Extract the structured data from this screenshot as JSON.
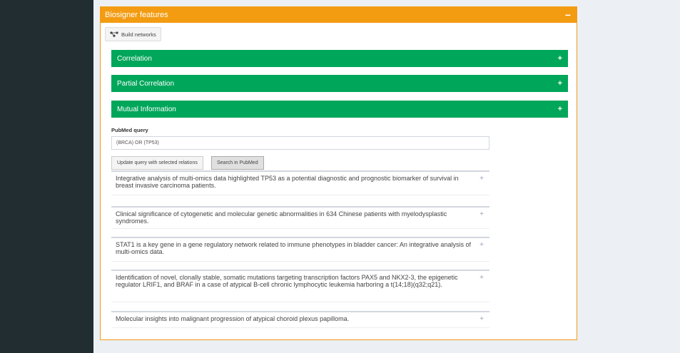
{
  "box": {
    "title": "Biosigner features",
    "collapse_symbol": "−",
    "build_label": "Build networks",
    "color": "#f39c12"
  },
  "panels": [
    {
      "label": "Correlation",
      "symbol": "+"
    },
    {
      "label": "Partial Correlation",
      "symbol": "+"
    },
    {
      "label": "Mutual Information",
      "symbol": "+"
    }
  ],
  "panel_color": "#00a65a",
  "pubmed": {
    "label": "PubMed query",
    "value": "(BRCA) OR (TP53)",
    "update_button": "Update query with selected relations",
    "search_button": "Search in PubMed"
  },
  "results": [
    {
      "title": "Integrative analysis of multi-omics data highlighted TP53 as a potential diagnostic and prognostic biomarker of survival in breast invasive carcinoma patients.",
      "symbol": "+"
    },
    {
      "title": "Clinical significance of cytogenetic and molecular genetic abnormalities in 634 Chinese patients with myelodysplastic syndromes.",
      "symbol": "+"
    },
    {
      "title": "STAT1 is a key gene in a gene regulatory network related to immune phenotypes in bladder cancer: An integrative analysis of multi-omics data.",
      "symbol": "+"
    },
    {
      "title": "Identification of novel, clonally stable, somatic mutations targeting transcription factors PAX5 and NKX2-3, the epigenetic regulator LRIF1, and BRAF in a case of atypical B-cell chronic lymphocytic leukemia harboring a t(14;18)(q32;q21).",
      "symbol": "+"
    },
    {
      "title": "Molecular insights into malignant progression of atypical choroid plexus papilloma.",
      "symbol": "+"
    }
  ]
}
